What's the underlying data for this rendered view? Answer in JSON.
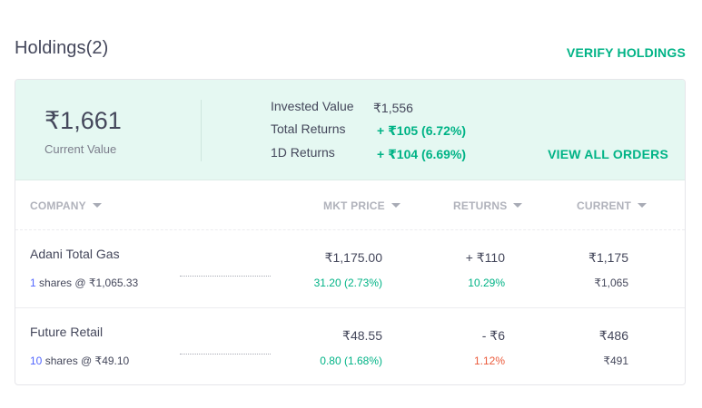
{
  "header": {
    "title": "Holdings(2)",
    "verify_label": "VERIFY HOLDINGS"
  },
  "summary": {
    "current_value": "₹1,661",
    "current_value_label": "Current Value",
    "invested_label": "Invested Value",
    "invested_value": "₹1,556",
    "total_returns_label": "Total Returns",
    "total_returns_value": "+ ₹105 (6.72%)",
    "day_returns_label": "1D Returns",
    "day_returns_value": "+ ₹104 (6.69%)",
    "view_orders_label": "VIEW ALL ORDERS"
  },
  "table": {
    "columns": [
      "COMPANY",
      "MKT PRICE",
      "RETURNS",
      "CURRENT"
    ],
    "rows": [
      {
        "company": "Adani Total Gas",
        "shares": "1",
        "shares_suffix": " shares @ ₹1,065.33",
        "mkt_price": "₹1,175.00",
        "day_change": "31.20 (2.73%)",
        "returns": "+ ₹110",
        "returns_pct": "10.29%",
        "current": "₹1,175",
        "invested": "₹1,065"
      },
      {
        "company": "Future Retail",
        "shares": "10",
        "shares_suffix": " shares @ ₹49.10",
        "mkt_price": "₹48.55",
        "day_change": "0.80 (1.68%)",
        "returns": "- ₹6",
        "returns_pct": "1.12%",
        "current": "₹486",
        "invested": "₹491"
      }
    ]
  },
  "colors": {
    "accent_green": "#00b386",
    "loss_red": "#eb5b3c",
    "summary_bg": "#e5f8f2",
    "share_count_blue": "#5367ff"
  },
  "icons": {
    "sort": "caret-down-icon"
  }
}
